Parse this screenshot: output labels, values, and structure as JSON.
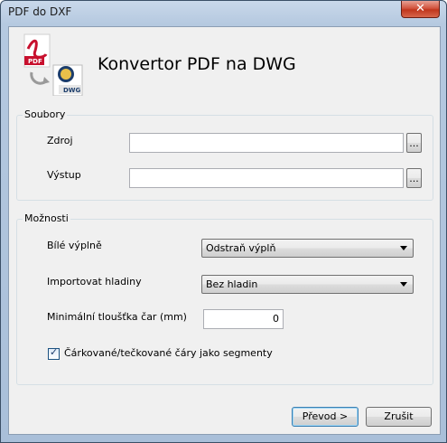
{
  "window": {
    "title": "PDF do DXF",
    "close_glyph": "✕"
  },
  "header": {
    "title": "Konvertor PDF na DWG",
    "icon_label_pdf": "PDF",
    "icon_label_dwg": "DWG"
  },
  "files_group": {
    "label": "Soubory",
    "source_label": "Zdroj",
    "source_value": "",
    "output_label": "Výstup",
    "output_value": "",
    "browse_label": "..."
  },
  "options_group": {
    "label": "Možnosti",
    "fill_label": "Bílé výplně",
    "fill_value": "Odstraň výplň",
    "layers_label": "Importovat hladiny",
    "layers_value": "Bez hladin",
    "min_width_label": "Minimální tloušťka čar (mm)",
    "min_width_value": "0",
    "dashed_label": "Čárkované/tečkované čáry jako segmenty",
    "dashed_checked": true
  },
  "buttons": {
    "convert": "Převod >",
    "close": "Zrušit"
  }
}
